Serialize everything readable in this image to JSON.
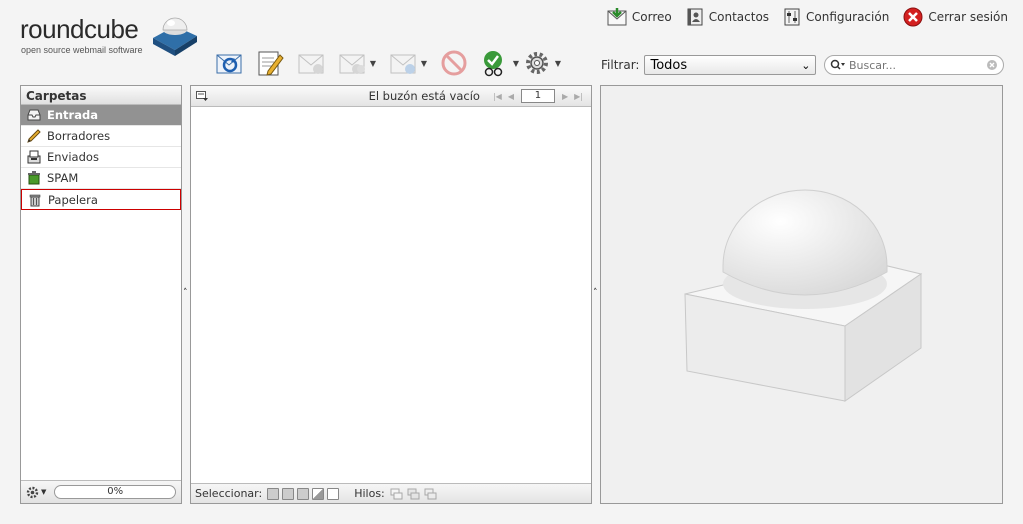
{
  "logo": {
    "name": "roundcube",
    "tagline": "open source webmail software"
  },
  "topnav": [
    {
      "label": "Correo",
      "icon": "mail-icon"
    },
    {
      "label": "Contactos",
      "icon": "addressbook-icon"
    },
    {
      "label": "Configuración",
      "icon": "settings-icon"
    },
    {
      "label": "Cerrar sesión",
      "icon": "logout-icon"
    }
  ],
  "filter": {
    "label": "Filtrar:",
    "value": "Todos"
  },
  "search": {
    "placeholder": "Buscar..."
  },
  "folders": {
    "title": "Carpetas",
    "items": [
      {
        "label": "Entrada",
        "icon": "inbox-icon"
      },
      {
        "label": "Borradores",
        "icon": "pencil-icon"
      },
      {
        "label": "Enviados",
        "icon": "sent-icon"
      },
      {
        "label": "SPAM",
        "icon": "spam-icon"
      },
      {
        "label": "Papelera",
        "icon": "trash-icon"
      }
    ],
    "quota": "0%"
  },
  "messagelist": {
    "status": "El buzón está vacío",
    "page": "1",
    "select_label": "Seleccionar:",
    "threads_label": "Hilos:"
  },
  "colors": {
    "selected_folder": "#929292",
    "focus_border": "#cc0000",
    "logo_blue": "#2f6fa8"
  }
}
